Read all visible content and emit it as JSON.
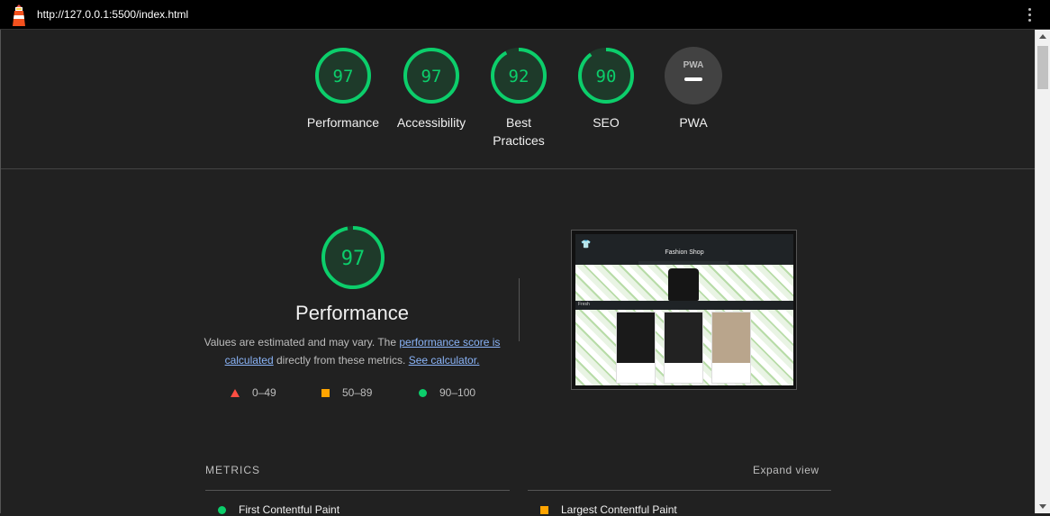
{
  "browser": {
    "url": "http://127.0.0.1:5500/index.html"
  },
  "scores": [
    {
      "value": "97",
      "label": "Performance"
    },
    {
      "value": "97",
      "label": "Accessibility"
    },
    {
      "value": "92",
      "label": "Best Practices",
      "label_lines": [
        "Best",
        "Practices"
      ]
    },
    {
      "value": "90",
      "label": "SEO"
    },
    {
      "value": "PWA",
      "label": "PWA"
    }
  ],
  "performance": {
    "score": "97",
    "title": "Performance",
    "desc_prefix": "Values are estimated and may vary. The ",
    "link_score": "performance score is calculated",
    "desc_middle": " directly from these metrics. ",
    "link_calc": "See calculator."
  },
  "legend": {
    "fail": "0–49",
    "average": "50–89",
    "pass": "90–100"
  },
  "thumbnail": {
    "site_title": "Fashion Shop",
    "section_label": "Fresh"
  },
  "metrics": {
    "header": "METRICS",
    "expand": "Expand view",
    "items": [
      {
        "name": "First Contentful Paint",
        "status": "pass"
      },
      {
        "name": "Largest Contentful Paint",
        "status": "average"
      }
    ]
  },
  "colors": {
    "pass": "#0cce6b",
    "average": "#ffa400",
    "fail": "#ff4e42",
    "background": "#212121",
    "link": "#8ab4f8"
  }
}
